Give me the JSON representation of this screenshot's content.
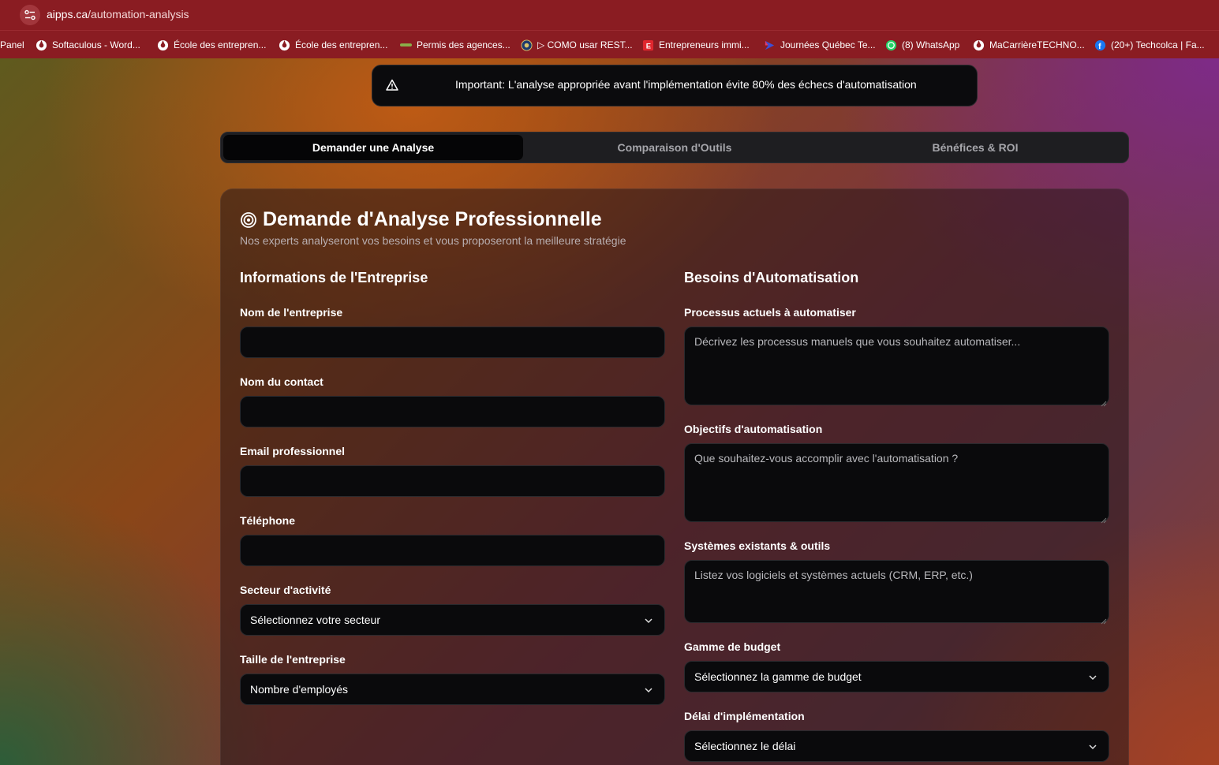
{
  "browser": {
    "url_host": "aipps.ca",
    "url_path": "/automation-analysis",
    "bookmarks": [
      {
        "label": "Panel",
        "icon": "none"
      },
      {
        "label": "Softaculous - Word...",
        "icon": "globe-icon"
      },
      {
        "label": "École des entrepren...",
        "icon": "globe-icon"
      },
      {
        "label": "École des entrepren...",
        "icon": "globe-icon"
      },
      {
        "label": "Permis des agences...",
        "icon": "leaf-logo-icon"
      },
      {
        "label": "▷ COMO usar REST...",
        "icon": "seal-icon"
      },
      {
        "label": "Entrepreneurs immi...",
        "icon": "e-logo-icon"
      },
      {
        "label": "Journées Québec Te...",
        "icon": "arrow-logo-icon"
      },
      {
        "label": "(8) WhatsApp",
        "icon": "whatsapp-icon"
      },
      {
        "label": "MaCarrièreTECHNO...",
        "icon": "globe-icon"
      },
      {
        "label": "(20+) Techcolca | Fa...",
        "icon": "facebook-icon"
      }
    ]
  },
  "alert": {
    "text": "Important: L'analyse appropriée avant l'implémentation évite 80% des échecs d'automatisation",
    "icon": "warning-triangle-icon"
  },
  "tabs": [
    {
      "label": "Demander une Analyse",
      "active": true
    },
    {
      "label": "Comparaison d'Outils",
      "active": false
    },
    {
      "label": "Bénéfices & ROI",
      "active": false
    }
  ],
  "card": {
    "title": "Demande d'Analyse Professionnelle",
    "subtitle": "Nos experts analyseront vos besoins et vous proposeront la meilleure stratégie",
    "icon": "target-icon"
  },
  "company": {
    "heading": "Informations de l'Entreprise",
    "company_name_label": "Nom de l'entreprise",
    "contact_name_label": "Nom du contact",
    "email_label": "Email professionnel",
    "phone_label": "Téléphone",
    "sector_label": "Secteur d'activité",
    "sector_value": "Sélectionnez votre secteur",
    "size_label": "Taille de l'entreprise",
    "size_value": "Nombre d'employés"
  },
  "needs": {
    "heading": "Besoins d'Automatisation",
    "processes_label": "Processus actuels à automatiser",
    "processes_placeholder": "Décrivez les processus manuels que vous souhaitez automatiser...",
    "goals_label": "Objectifs d'automatisation",
    "goals_placeholder": "Que souhaitez-vous accomplir avec l'automatisation ?",
    "systems_label": "Systèmes existants & outils",
    "systems_placeholder": "Listez vos logiciels et systèmes actuels (CRM, ERP, etc.)",
    "budget_label": "Gamme de budget",
    "budget_value": "Sélectionnez la gamme de budget",
    "timeline_label": "Délai d'implémentation",
    "timeline_value": "Sélectionnez le délai"
  }
}
